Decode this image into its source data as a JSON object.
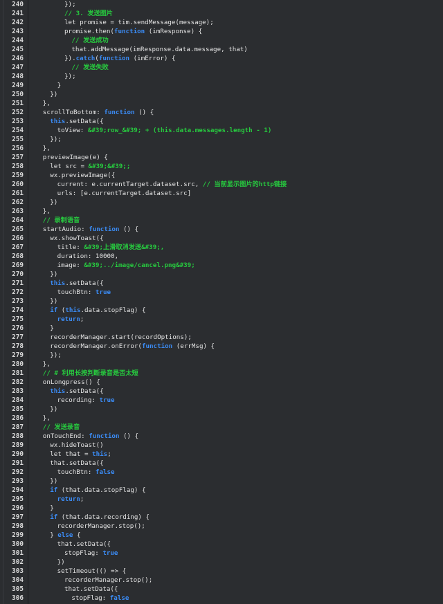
{
  "window": {
    "title": "code-editor"
  },
  "colors": {
    "background": "#2b2d30",
    "plain": "#e4e4e4",
    "keyword": "#3b8cf6",
    "comment": "#27c93f",
    "string": "#27c93f",
    "line_number": "#d8d8d8"
  },
  "lines": [
    {
      "n": "240",
      "indent": 10,
      "tokens": [
        {
          "t": "pl",
          "v": "});"
        }
      ]
    },
    {
      "n": "241",
      "indent": 10,
      "tokens": [
        {
          "t": "cm",
          "v": "// 3. 发送图片"
        }
      ]
    },
    {
      "n": "242",
      "indent": 10,
      "tokens": [
        {
          "t": "pl",
          "v": "let promise = tim.sendMessage(message);"
        }
      ]
    },
    {
      "n": "243",
      "indent": 10,
      "tokens": [
        {
          "t": "pl",
          "v": "promise.then("
        },
        {
          "t": "kw",
          "v": "function"
        },
        {
          "t": "pl",
          "v": " (imResponse) {"
        }
      ]
    },
    {
      "n": "244",
      "indent": 12,
      "tokens": [
        {
          "t": "cm",
          "v": "// 发送成功"
        }
      ]
    },
    {
      "n": "245",
      "indent": 12,
      "tokens": [
        {
          "t": "pl",
          "v": "that.addMessage(imResponse.data.message, that)"
        }
      ]
    },
    {
      "n": "246",
      "indent": 10,
      "tokens": [
        {
          "t": "pl",
          "v": "})."
        },
        {
          "t": "kw",
          "v": "catch"
        },
        {
          "t": "pl",
          "v": "("
        },
        {
          "t": "kw",
          "v": "function"
        },
        {
          "t": "pl",
          "v": " (imError) {"
        }
      ]
    },
    {
      "n": "247",
      "indent": 12,
      "tokens": [
        {
          "t": "cm",
          "v": "// 发送失败"
        }
      ]
    },
    {
      "n": "248",
      "indent": 10,
      "tokens": [
        {
          "t": "pl",
          "v": "});"
        }
      ]
    },
    {
      "n": "249",
      "indent": 8,
      "tokens": [
        {
          "t": "pl",
          "v": "}"
        }
      ]
    },
    {
      "n": "250",
      "indent": 6,
      "tokens": [
        {
          "t": "pl",
          "v": "})"
        }
      ]
    },
    {
      "n": "251",
      "indent": 4,
      "tokens": [
        {
          "t": "pl",
          "v": "},"
        }
      ]
    },
    {
      "n": "252",
      "indent": 4,
      "tokens": [
        {
          "t": "pl",
          "v": "scrollToBottom: "
        },
        {
          "t": "kw",
          "v": "function"
        },
        {
          "t": "pl",
          "v": " () {"
        }
      ]
    },
    {
      "n": "253",
      "indent": 6,
      "tokens": [
        {
          "t": "kw",
          "v": "this"
        },
        {
          "t": "pl",
          "v": ".setData({"
        }
      ]
    },
    {
      "n": "254",
      "indent": 8,
      "tokens": [
        {
          "t": "pl",
          "v": "toView: "
        },
        {
          "t": "str",
          "v": "&#39;row_&#39; + (this.data.messages.length - 1)"
        }
      ]
    },
    {
      "n": "255",
      "indent": 6,
      "tokens": [
        {
          "t": "pl",
          "v": "});"
        }
      ]
    },
    {
      "n": "256",
      "indent": 4,
      "tokens": [
        {
          "t": "pl",
          "v": "},"
        }
      ]
    },
    {
      "n": "257",
      "indent": 4,
      "tokens": [
        {
          "t": "pl",
          "v": "previewImage(e) {"
        }
      ]
    },
    {
      "n": "258",
      "indent": 6,
      "tokens": [
        {
          "t": "pl",
          "v": "let src = "
        },
        {
          "t": "str",
          "v": "&#39;&#39;;"
        }
      ]
    },
    {
      "n": "259",
      "indent": 6,
      "tokens": [
        {
          "t": "pl",
          "v": "wx.previewImage({"
        }
      ]
    },
    {
      "n": "260",
      "indent": 8,
      "tokens": [
        {
          "t": "pl",
          "v": "current: e.currentTarget.dataset.src, "
        },
        {
          "t": "cm",
          "v": "// 当前显示图片的http链接"
        }
      ]
    },
    {
      "n": "261",
      "indent": 8,
      "tokens": [
        {
          "t": "pl",
          "v": "urls: [e.currentTarget.dataset.src]"
        }
      ]
    },
    {
      "n": "262",
      "indent": 6,
      "tokens": [
        {
          "t": "pl",
          "v": "})"
        }
      ]
    },
    {
      "n": "263",
      "indent": 4,
      "tokens": [
        {
          "t": "pl",
          "v": "},"
        }
      ]
    },
    {
      "n": "264",
      "indent": 4,
      "tokens": [
        {
          "t": "cm",
          "v": "// 录制语音"
        }
      ]
    },
    {
      "n": "265",
      "indent": 4,
      "tokens": [
        {
          "t": "pl",
          "v": "startAudio: "
        },
        {
          "t": "kw",
          "v": "function"
        },
        {
          "t": "pl",
          "v": " () {"
        }
      ]
    },
    {
      "n": "266",
      "indent": 6,
      "tokens": [
        {
          "t": "pl",
          "v": "wx.showToast({"
        }
      ]
    },
    {
      "n": "267",
      "indent": 8,
      "tokens": [
        {
          "t": "pl",
          "v": "title: "
        },
        {
          "t": "str",
          "v": "&#39;上滑取消发送&#39;,"
        }
      ]
    },
    {
      "n": "268",
      "indent": 8,
      "tokens": [
        {
          "t": "pl",
          "v": "duration: 10000,"
        }
      ]
    },
    {
      "n": "269",
      "indent": 8,
      "tokens": [
        {
          "t": "pl",
          "v": "image: "
        },
        {
          "t": "str",
          "v": "&#39;../image/cancel.png&#39;"
        }
      ]
    },
    {
      "n": "270",
      "indent": 6,
      "tokens": [
        {
          "t": "pl",
          "v": "})"
        }
      ]
    },
    {
      "n": "271",
      "indent": 6,
      "tokens": [
        {
          "t": "kw",
          "v": "this"
        },
        {
          "t": "pl",
          "v": ".setData({"
        }
      ]
    },
    {
      "n": "272",
      "indent": 8,
      "tokens": [
        {
          "t": "pl",
          "v": "touchBtn: "
        },
        {
          "t": "kw",
          "v": "true"
        }
      ]
    },
    {
      "n": "273",
      "indent": 6,
      "tokens": [
        {
          "t": "pl",
          "v": "})"
        }
      ]
    },
    {
      "n": "274",
      "indent": 6,
      "tokens": [
        {
          "t": "kw",
          "v": "if"
        },
        {
          "t": "pl",
          "v": " ("
        },
        {
          "t": "kw",
          "v": "this"
        },
        {
          "t": "pl",
          "v": ".data.stopFlag) {"
        }
      ]
    },
    {
      "n": "275",
      "indent": 8,
      "tokens": [
        {
          "t": "kw",
          "v": "return"
        },
        {
          "t": "pl",
          "v": ";"
        }
      ]
    },
    {
      "n": "276",
      "indent": 6,
      "tokens": [
        {
          "t": "pl",
          "v": "}"
        }
      ]
    },
    {
      "n": "277",
      "indent": 6,
      "tokens": [
        {
          "t": "pl",
          "v": "recorderManager.start(recordOptions);"
        }
      ]
    },
    {
      "n": "278",
      "indent": 6,
      "tokens": [
        {
          "t": "pl",
          "v": "recorderManager.onError("
        },
        {
          "t": "kw",
          "v": "function"
        },
        {
          "t": "pl",
          "v": " (errMsg) {"
        }
      ]
    },
    {
      "n": "279",
      "indent": 6,
      "tokens": [
        {
          "t": "pl",
          "v": "});"
        }
      ]
    },
    {
      "n": "280",
      "indent": 4,
      "tokens": [
        {
          "t": "pl",
          "v": "},"
        }
      ]
    },
    {
      "n": "281",
      "indent": 4,
      "tokens": [
        {
          "t": "cm",
          "v": "// # 利用长按判断录音是否太短"
        }
      ]
    },
    {
      "n": "282",
      "indent": 4,
      "tokens": [
        {
          "t": "pl",
          "v": "onLongpress() {"
        }
      ]
    },
    {
      "n": "283",
      "indent": 6,
      "tokens": [
        {
          "t": "kw",
          "v": "this"
        },
        {
          "t": "pl",
          "v": ".setData({"
        }
      ]
    },
    {
      "n": "284",
      "indent": 8,
      "tokens": [
        {
          "t": "pl",
          "v": "recording: "
        },
        {
          "t": "kw",
          "v": "true"
        }
      ]
    },
    {
      "n": "285",
      "indent": 6,
      "tokens": [
        {
          "t": "pl",
          "v": "})"
        }
      ]
    },
    {
      "n": "286",
      "indent": 4,
      "tokens": [
        {
          "t": "pl",
          "v": "},"
        }
      ]
    },
    {
      "n": "287",
      "indent": 4,
      "tokens": [
        {
          "t": "cm",
          "v": "// 发送录音"
        }
      ]
    },
    {
      "n": "288",
      "indent": 4,
      "tokens": [
        {
          "t": "pl",
          "v": "onTouchEnd: "
        },
        {
          "t": "kw",
          "v": "function"
        },
        {
          "t": "pl",
          "v": " () {"
        }
      ]
    },
    {
      "n": "289",
      "indent": 6,
      "tokens": [
        {
          "t": "pl",
          "v": "wx.hideToast()"
        }
      ]
    },
    {
      "n": "290",
      "indent": 6,
      "tokens": [
        {
          "t": "pl",
          "v": "let that = "
        },
        {
          "t": "kw",
          "v": "this"
        },
        {
          "t": "pl",
          "v": ";"
        }
      ]
    },
    {
      "n": "291",
      "indent": 6,
      "tokens": [
        {
          "t": "pl",
          "v": "that.setData({"
        }
      ]
    },
    {
      "n": "292",
      "indent": 8,
      "tokens": [
        {
          "t": "pl",
          "v": "touchBtn: "
        },
        {
          "t": "kw",
          "v": "false"
        }
      ]
    },
    {
      "n": "293",
      "indent": 6,
      "tokens": [
        {
          "t": "pl",
          "v": "})"
        }
      ]
    },
    {
      "n": "294",
      "indent": 6,
      "tokens": [
        {
          "t": "kw",
          "v": "if"
        },
        {
          "t": "pl",
          "v": " (that.data.stopFlag) {"
        }
      ]
    },
    {
      "n": "295",
      "indent": 8,
      "tokens": [
        {
          "t": "kw",
          "v": "return"
        },
        {
          "t": "pl",
          "v": ";"
        }
      ]
    },
    {
      "n": "296",
      "indent": 6,
      "tokens": [
        {
          "t": "pl",
          "v": "}"
        }
      ]
    },
    {
      "n": "297",
      "indent": 6,
      "tokens": [
        {
          "t": "kw",
          "v": "if"
        },
        {
          "t": "pl",
          "v": " (that.data.recording) {"
        }
      ]
    },
    {
      "n": "298",
      "indent": 8,
      "tokens": [
        {
          "t": "pl",
          "v": "recorderManager.stop();"
        }
      ]
    },
    {
      "n": "299",
      "indent": 6,
      "tokens": [
        {
          "t": "pl",
          "v": "} "
        },
        {
          "t": "kw",
          "v": "else"
        },
        {
          "t": "pl",
          "v": " {"
        }
      ]
    },
    {
      "n": "300",
      "indent": 8,
      "tokens": [
        {
          "t": "pl",
          "v": "that.setData({"
        }
      ]
    },
    {
      "n": "301",
      "indent": 10,
      "tokens": [
        {
          "t": "pl",
          "v": "stopFlag: "
        },
        {
          "t": "kw",
          "v": "true"
        }
      ]
    },
    {
      "n": "302",
      "indent": 8,
      "tokens": [
        {
          "t": "pl",
          "v": "})"
        }
      ]
    },
    {
      "n": "303",
      "indent": 8,
      "tokens": [
        {
          "t": "pl",
          "v": "setTimeout(() => {"
        }
      ]
    },
    {
      "n": "304",
      "indent": 10,
      "tokens": [
        {
          "t": "pl",
          "v": "recorderManager.stop();"
        }
      ]
    },
    {
      "n": "305",
      "indent": 10,
      "tokens": [
        {
          "t": "pl",
          "v": "that.setData({"
        }
      ]
    },
    {
      "n": "306",
      "indent": 12,
      "tokens": [
        {
          "t": "pl",
          "v": "stopFlag: "
        },
        {
          "t": "kw",
          "v": "false"
        }
      ]
    }
  ]
}
